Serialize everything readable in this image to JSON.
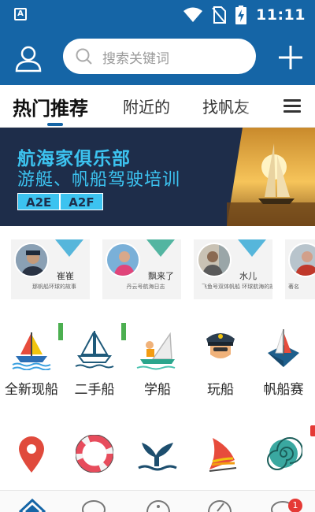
{
  "status_bar": {
    "time": "11:11",
    "notification_icon": "a-badge-icon",
    "icons": [
      "wifi-icon",
      "no-sim-icon",
      "battery-charging-icon"
    ]
  },
  "header": {
    "search_placeholder": "搜索关键词",
    "left_icon": "user-icon",
    "right_icon": "plus-icon",
    "color": "#1565a6"
  },
  "tabs": [
    {
      "label": "热门推荐",
      "active": true
    },
    {
      "label": "附近的",
      "active": false
    },
    {
      "label": "找帆友",
      "active": false
    }
  ],
  "banner": {
    "title": "航海家俱乐部",
    "subtitle": "游艇、帆船驾驶培训",
    "badges": [
      "A2E",
      "A2F"
    ]
  },
  "users": [
    {
      "name": "崔崔",
      "desc": "那帆船环球的故事"
    },
    {
      "name": "飘来了",
      "desc": "丹云号航海日志"
    },
    {
      "name": "水儿",
      "desc": "飞鱼号双体帆船 环球航海的故事"
    },
    {
      "name": "",
      "desc": "著名"
    }
  ],
  "categories_row1": [
    {
      "label": "全新现船",
      "icon": "sailboat-icon"
    },
    {
      "label": "二手船",
      "icon": "sailboat-outline-icon"
    },
    {
      "label": "学船",
      "icon": "learn-sailing-icon"
    },
    {
      "label": "玩船",
      "icon": "captain-icon"
    },
    {
      "label": "帆船赛",
      "icon": "regatta-icon"
    }
  ],
  "categories_row2": [
    {
      "label": "",
      "icon": "location-pin-icon"
    },
    {
      "label": "",
      "icon": "lifebuoy-icon"
    },
    {
      "label": "",
      "icon": "whale-tail-icon"
    },
    {
      "label": "",
      "icon": "sail-flag-icon"
    },
    {
      "label": "",
      "icon": "shell-icon"
    }
  ],
  "bottom_nav": {
    "icons": [
      "home-icon",
      "chat-icon",
      "discover-icon",
      "compass-icon",
      "message-icon"
    ],
    "badge": "1"
  },
  "colors": {
    "primary": "#1565a6",
    "banner_bg": "#1e2d4a",
    "banner_text": "#3cc3f0",
    "badge_red": "#e53935"
  }
}
